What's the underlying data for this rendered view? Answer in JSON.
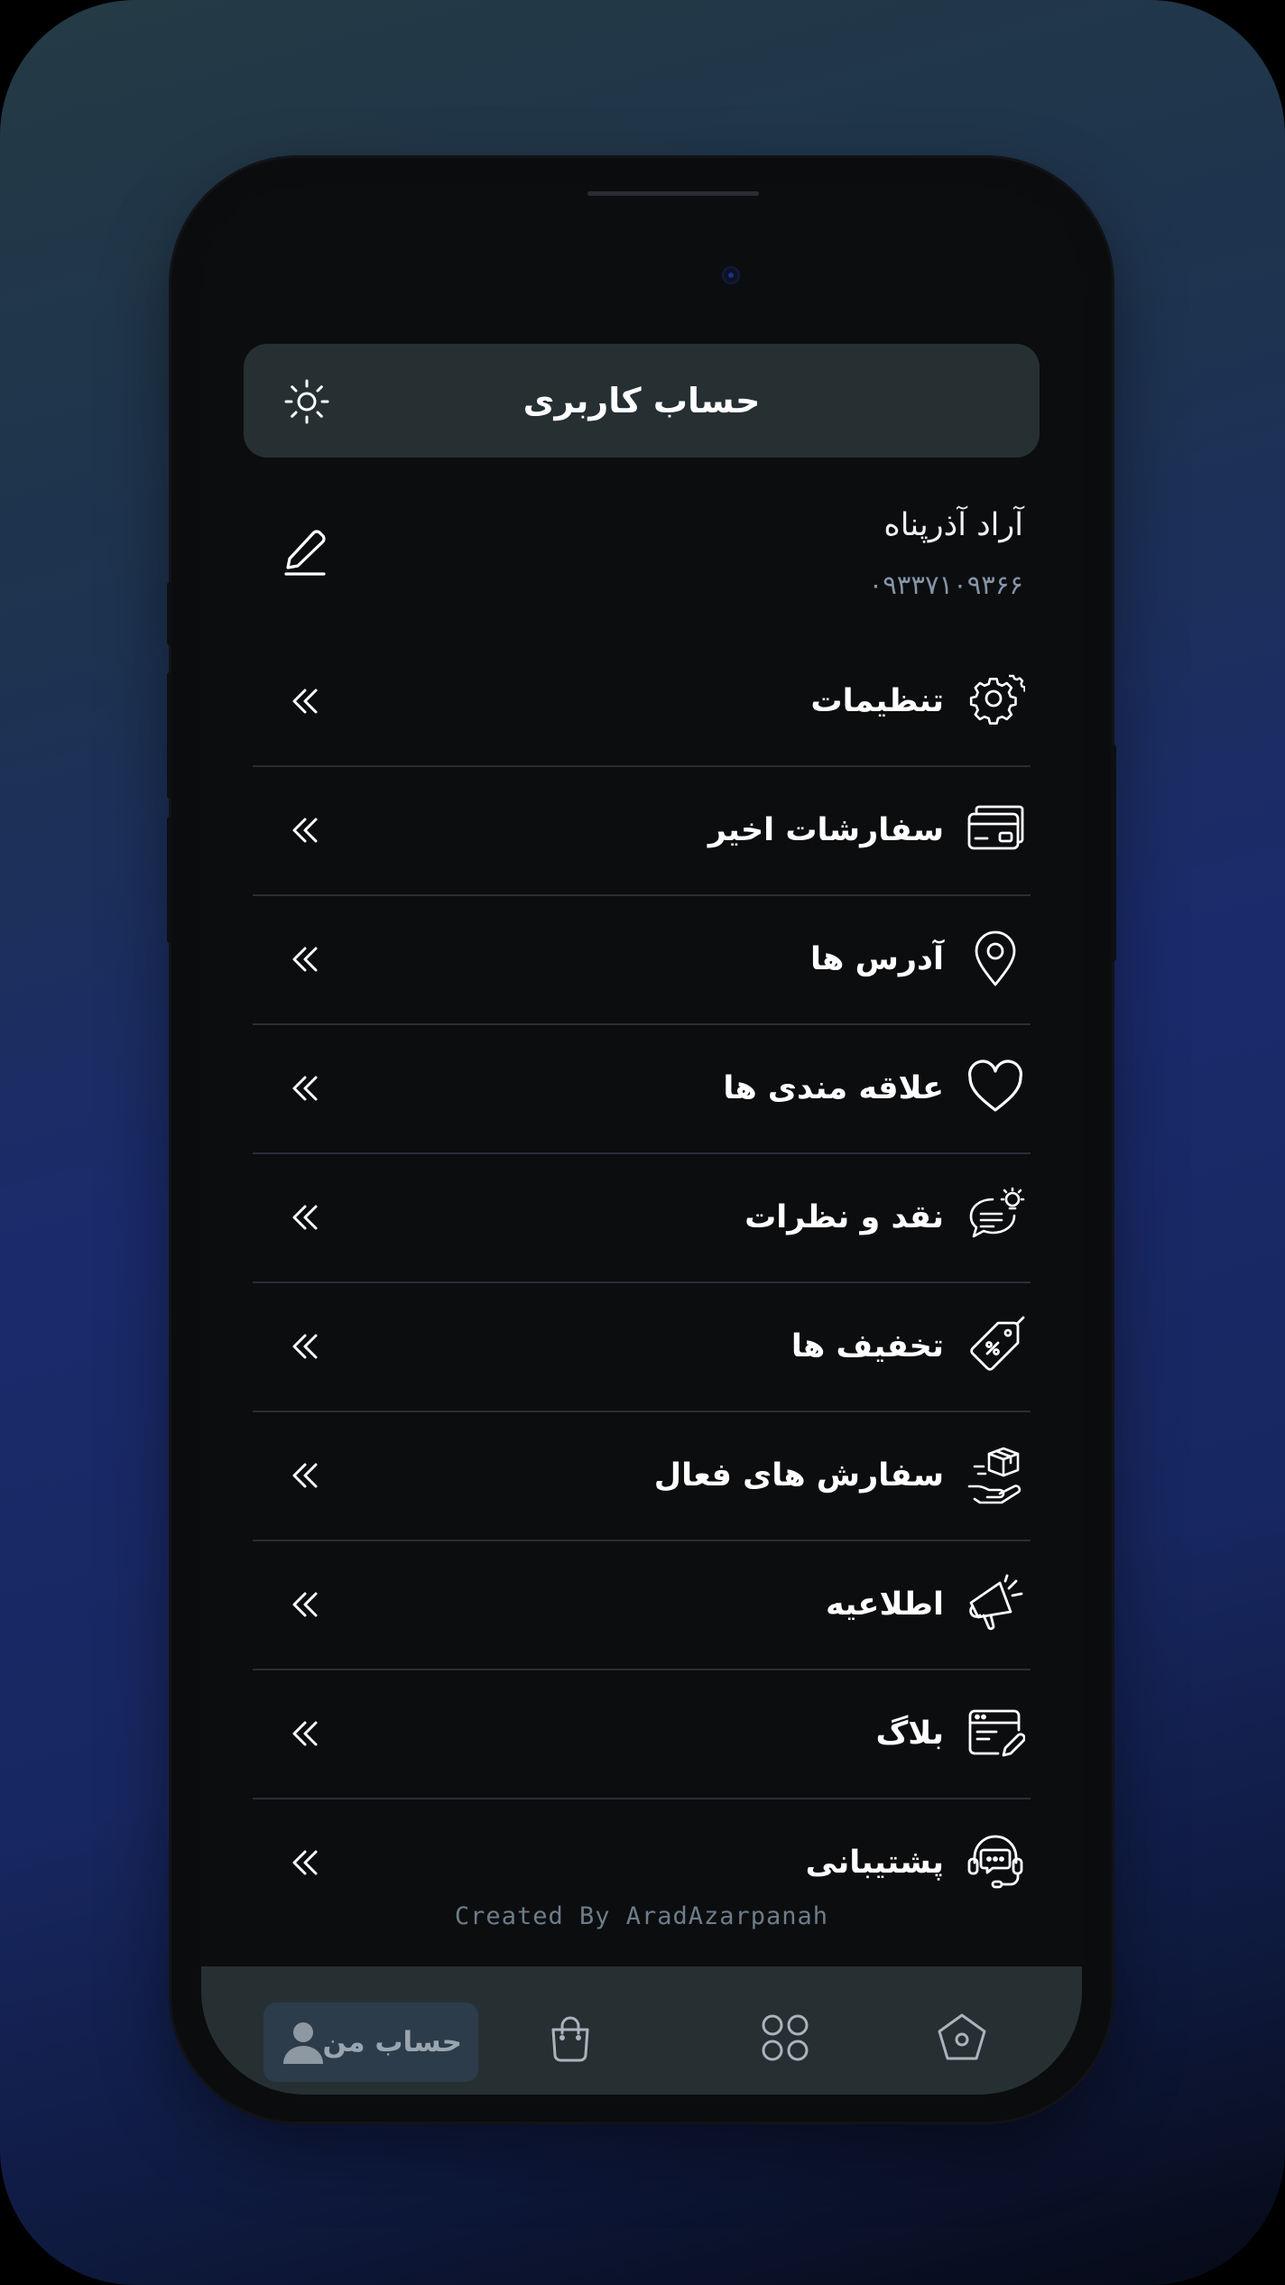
{
  "header": {
    "title": "حساب کاربری",
    "theme_icon": "sun-icon"
  },
  "profile": {
    "name": "آراد آذرپناه",
    "phone": "۰۹۳۳۷۱۰۹۳۶۶",
    "edit_icon": "edit-pencil-icon"
  },
  "menu": {
    "items": [
      {
        "label": "تنظیمات",
        "icon": "gear-icon"
      },
      {
        "label": "سفارشات اخیر",
        "icon": "credit-card-icon"
      },
      {
        "label": "آدرس ها",
        "icon": "location-pin-icon"
      },
      {
        "label": "علاقه مندی ها",
        "icon": "heart-icon"
      },
      {
        "label": "نقد و نظرات",
        "icon": "comment-idea-icon"
      },
      {
        "label": "تخفیف ها",
        "icon": "discount-tag-icon"
      },
      {
        "label": "سفارش های فعال",
        "icon": "package-hand-icon"
      },
      {
        "label": "اطلاعیه",
        "icon": "megaphone-icon"
      },
      {
        "label": "بلاگ",
        "icon": "blog-edit-icon"
      },
      {
        "label": "پشتیبانی",
        "icon": "headset-support-icon"
      }
    ]
  },
  "footer": {
    "credit": "Created By AradAzarpanah"
  },
  "bottom_nav": {
    "active_label": "حساب من",
    "items": [
      "user-icon",
      "bag-icon",
      "grid-icon",
      "home-icon"
    ]
  },
  "colors": {
    "accent_header": "#263033",
    "screen_bg": "#0c0d0f",
    "phone_number": "#8694a8",
    "active_nav": "#2c3c4a"
  }
}
